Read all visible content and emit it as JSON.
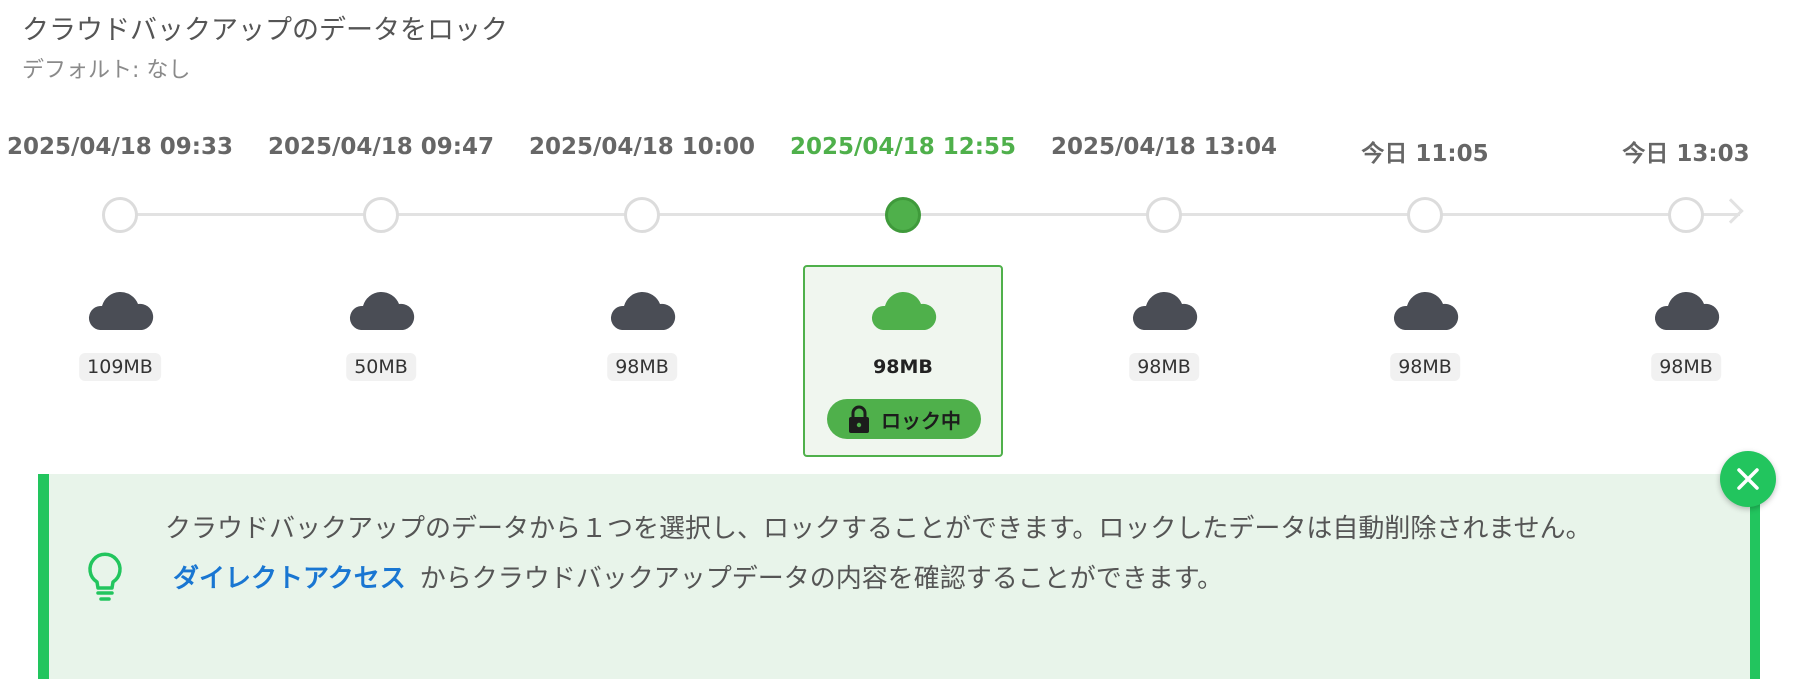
{
  "header": {
    "title": "クラウドバックアップのデータをロック",
    "default_text": "デフォルト: なし"
  },
  "colors": {
    "accent": "#4fb04b",
    "cloud_default": "#4a4d55",
    "info_border": "#22c55e",
    "info_bg": "#e8f4ea",
    "link": "#1976d2"
  },
  "snapshots": [
    {
      "date": "2025/04/18 09:33",
      "size": "109MB",
      "selected": false
    },
    {
      "date": "2025/04/18 09:47",
      "size": "50MB",
      "selected": false
    },
    {
      "date": "2025/04/18 10:00",
      "size": "98MB",
      "selected": false
    },
    {
      "date": "2025/04/18 12:55",
      "size": "98MB",
      "selected": true
    },
    {
      "date": "2025/04/18 13:04",
      "size": "98MB",
      "selected": false
    },
    {
      "date": "今日 11:05",
      "size": "98MB",
      "selected": false
    },
    {
      "date": "今日 13:03",
      "size": "98MB",
      "selected": false
    }
  ],
  "lock_badge": {
    "label": "ロック中",
    "icon": "lock-icon"
  },
  "info": {
    "line1": "クラウドバックアップのデータから１つを選択し、ロックすることができます。ロックしたデータは自動削除されません。",
    "link_text": "ダイレクトアクセス",
    "line2_suffix": "からクラウドバックアップデータの内容を確認することができます。",
    "icon": "lightbulb-icon"
  },
  "close_button": {
    "icon": "close-icon"
  }
}
